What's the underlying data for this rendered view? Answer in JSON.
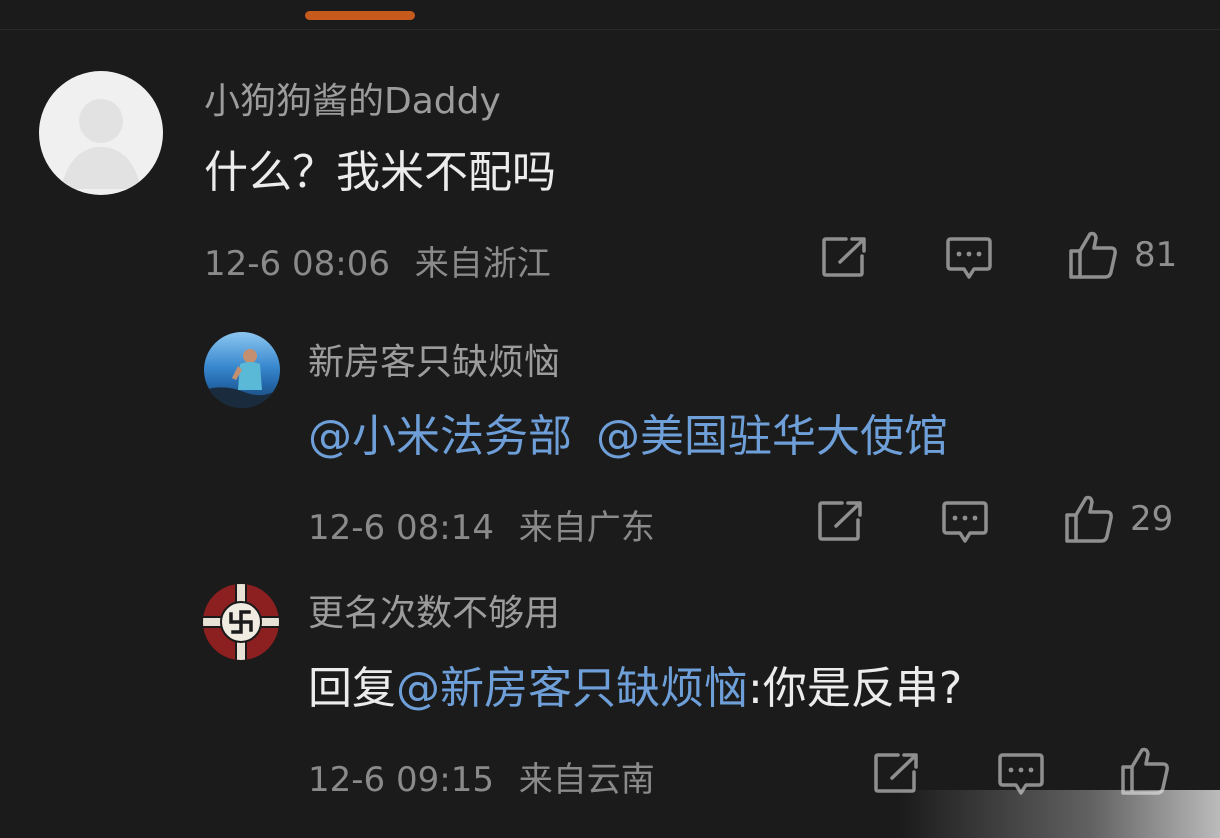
{
  "comments": [
    {
      "username": "小狗狗酱的Daddy",
      "content_text": "什么？我米不配吗",
      "time": "12-6 08:06",
      "location": "来自浙江",
      "likes": "81",
      "avatar": "default-person-avatar"
    },
    {
      "username": "新房客只缺烦恼",
      "mention_1": "@小米法务部",
      "mention_2": "@美国驻华大使馆",
      "time": "12-6 08:14",
      "location": "来自广东",
      "likes": "29",
      "avatar": "photo-avatar"
    },
    {
      "username": "更名次数不够用",
      "reply_prefix": "回复",
      "reply_mention": "@新房客只缺烦恼",
      "reply_text": ":你是反串?",
      "time": "12-6 09:15",
      "location": "来自云南",
      "likes": "",
      "avatar": "flag-emblem-avatar"
    }
  ],
  "icons": {
    "share": "share-icon",
    "comment": "comment-icon",
    "like": "thumbs-up-icon"
  },
  "colors": {
    "background": "#1b1b1b",
    "mention": "#6e9fd8",
    "accent": "#c65a1c"
  }
}
